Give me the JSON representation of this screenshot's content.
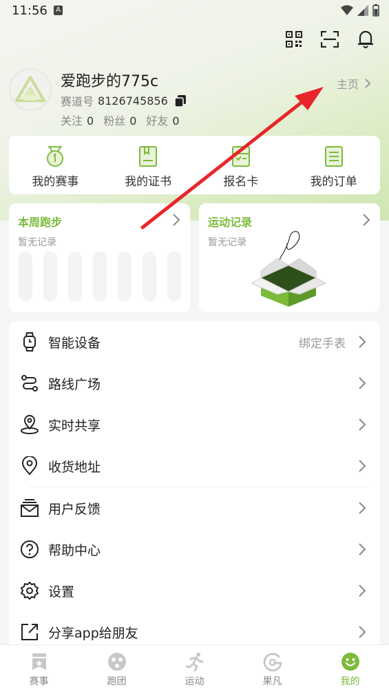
{
  "status_bar": {
    "time": "11:56",
    "notif": "A"
  },
  "profile": {
    "username": "爱跑步的775c",
    "track_label": "赛道号",
    "track_number": "8126745856",
    "following_label": "关注",
    "following_count": "0",
    "fans_label": "粉丝",
    "fans_count": "0",
    "friends_label": "好友",
    "friends_count": "0",
    "homepage_label": "主页"
  },
  "quick_actions": [
    {
      "label": "我的赛事",
      "icon": "medal-icon"
    },
    {
      "label": "我的证书",
      "icon": "certificate-icon"
    },
    {
      "label": "报名卡",
      "icon": "signup-card-icon"
    },
    {
      "label": "我的订单",
      "icon": "order-list-icon"
    }
  ],
  "weekly_run": {
    "title": "本周跑步",
    "empty_text": "暂无记录"
  },
  "exercise_record": {
    "title": "运动记录",
    "empty_text": "暂无记录"
  },
  "menu": [
    {
      "label": "智能设备",
      "value": "绑定手表",
      "icon": "watch-icon"
    },
    {
      "label": "路线广场",
      "value": "",
      "icon": "route-icon"
    },
    {
      "label": "实时共享",
      "value": "",
      "icon": "location-share-icon"
    },
    {
      "label": "收货地址",
      "value": "",
      "icon": "address-pin-icon"
    },
    {
      "label": "用户反馈",
      "value": "",
      "icon": "feedback-icon"
    },
    {
      "label": "帮助中心",
      "value": "",
      "icon": "help-icon"
    },
    {
      "label": "设置",
      "value": "",
      "icon": "settings-icon"
    },
    {
      "label": "分享app给朋友",
      "value": "",
      "icon": "share-icon"
    }
  ],
  "bottom_nav": [
    {
      "label": "赛事",
      "active": false
    },
    {
      "label": "跑团",
      "active": false
    },
    {
      "label": "运动",
      "active": false
    },
    {
      "label": "果凡",
      "active": false
    },
    {
      "label": "我的",
      "active": true
    }
  ],
  "colors": {
    "accent": "#7cbb3a",
    "arrow": "#e8262b"
  }
}
